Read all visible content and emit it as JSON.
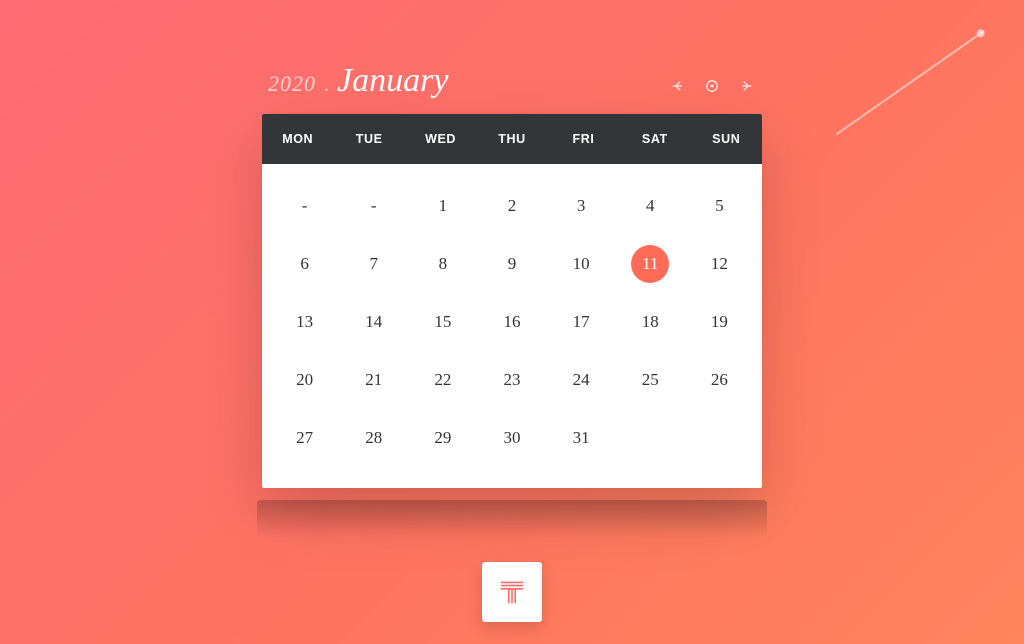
{
  "calendar": {
    "year": "2020",
    "separator": ".",
    "month": "January",
    "weekdays": [
      "MON",
      "TUE",
      "WED",
      "THU",
      "FRI",
      "SAT",
      "SUN"
    ],
    "emptyLabel": "-",
    "days": [
      {
        "v": "-",
        "empty": true
      },
      {
        "v": "-",
        "empty": true
      },
      {
        "v": "1"
      },
      {
        "v": "2"
      },
      {
        "v": "3"
      },
      {
        "v": "4"
      },
      {
        "v": "5"
      },
      {
        "v": "6"
      },
      {
        "v": "7"
      },
      {
        "v": "8"
      },
      {
        "v": "9"
      },
      {
        "v": "10"
      },
      {
        "v": "11",
        "selected": true
      },
      {
        "v": "12"
      },
      {
        "v": "13"
      },
      {
        "v": "14"
      },
      {
        "v": "15"
      },
      {
        "v": "16"
      },
      {
        "v": "17"
      },
      {
        "v": "18"
      },
      {
        "v": "19"
      },
      {
        "v": "20"
      },
      {
        "v": "21"
      },
      {
        "v": "22"
      },
      {
        "v": "23"
      },
      {
        "v": "24"
      },
      {
        "v": "25"
      },
      {
        "v": "26"
      },
      {
        "v": "27"
      },
      {
        "v": "28"
      },
      {
        "v": "29"
      },
      {
        "v": "30"
      },
      {
        "v": "31"
      }
    ]
  },
  "colors": {
    "accent": "#ff6b56",
    "headerBg": "#333639"
  },
  "logo": {
    "letter": "T"
  }
}
